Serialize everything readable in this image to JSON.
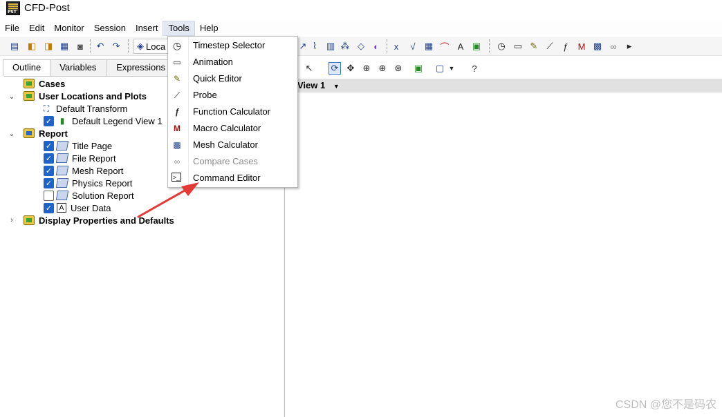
{
  "window": {
    "title": "CFD-Post",
    "logo_text": "PST"
  },
  "menubar": {
    "items": [
      "File",
      "Edit",
      "Monitor",
      "Session",
      "Insert",
      "Tools",
      "Help"
    ]
  },
  "toolbar": {
    "location_label": "Loca"
  },
  "left_panel": {
    "tabs": [
      "Outline",
      "Variables",
      "Expressions"
    ],
    "tree": {
      "cases": "Cases",
      "user_locations": "User Locations and Plots",
      "default_transform": "Default Transform",
      "default_legend": "Default Legend View 1",
      "report": "Report",
      "report_items": [
        {
          "label": "Title Page",
          "checked": true
        },
        {
          "label": "File Report",
          "checked": true
        },
        {
          "label": "Mesh Report",
          "checked": true
        },
        {
          "label": "Physics Report",
          "checked": true
        },
        {
          "label": "Solution Report",
          "checked": false
        },
        {
          "label": "User Data",
          "checked": true
        }
      ],
      "display_properties": "Display Properties and Defaults"
    }
  },
  "view": {
    "title": "View 1"
  },
  "tools_menu": {
    "items": [
      {
        "label": "Timestep Selector",
        "icon": "clock-icon",
        "enabled": true
      },
      {
        "label": "Animation",
        "icon": "film-icon",
        "enabled": true
      },
      {
        "label": "Quick Editor",
        "icon": "quick-editor-icon",
        "enabled": true
      },
      {
        "label": "Probe",
        "icon": "probe-icon",
        "enabled": true
      },
      {
        "label": "Function Calculator",
        "icon": "function-icon",
        "enabled": true
      },
      {
        "label": "Macro Calculator",
        "icon": "macro-icon",
        "enabled": true
      },
      {
        "label": "Mesh Calculator",
        "icon": "mesh-icon",
        "enabled": true
      },
      {
        "label": "Compare Cases",
        "icon": "compare-icon",
        "enabled": false
      },
      {
        "label": "Command Editor",
        "icon": "terminal-icon",
        "enabled": true
      }
    ]
  },
  "watermark": "CSDN @您不是码农",
  "colors": {
    "accent": "#1d63c8",
    "annotation_arrow": "#e53935",
    "menu_active": "#e3e8f3"
  }
}
